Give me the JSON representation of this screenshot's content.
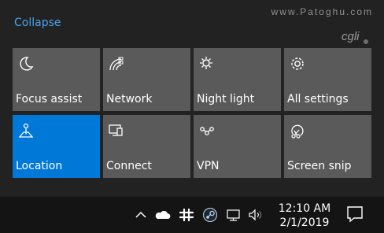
{
  "action_center": {
    "collapse_label": "Collapse",
    "watermark_text": "www.Patoghu.com",
    "watermark_logo_text": "cgli",
    "accent_color": "#0078d7",
    "tiles": [
      {
        "label": "Focus assist",
        "icon": "moon-icon",
        "active": false
      },
      {
        "label": "Network",
        "icon": "network-signal-icon",
        "active": false
      },
      {
        "label": "Night light",
        "icon": "sun-icon",
        "active": false
      },
      {
        "label": "All settings",
        "icon": "gear-icon",
        "active": false
      },
      {
        "label": "Location",
        "icon": "location-icon",
        "active": true
      },
      {
        "label": "Connect",
        "icon": "connect-icon",
        "active": false
      },
      {
        "label": "VPN",
        "icon": "vpn-icon",
        "active": false
      },
      {
        "label": "Screen snip",
        "icon": "screen-snip-icon",
        "active": false
      }
    ]
  },
  "taskbar": {
    "tray_icons": [
      "chevron-up-icon",
      "onedrive-icon",
      "slack-icon",
      "steam-icon",
      "network-icon",
      "volume-icon"
    ],
    "time": "12:10 AM",
    "date": "2/1/2019",
    "notification_icon": "notification-icon"
  }
}
